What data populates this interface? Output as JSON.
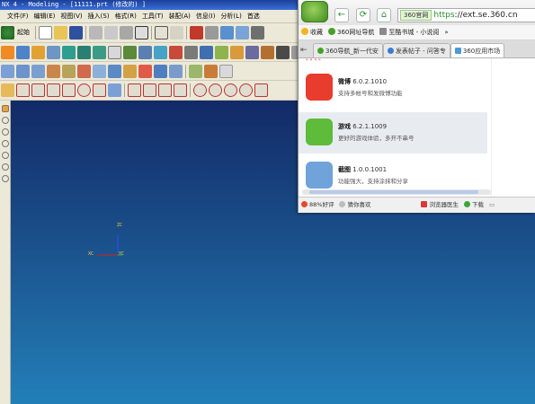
{
  "nx": {
    "title": "NX 4 - Modeling - [11111.prt  (修改的) ]",
    "menu": [
      "文件(F)",
      "编辑(E)",
      "视图(V)",
      "插入(S)",
      "格式(R)",
      "工具(T)",
      "装配(A)",
      "信息(I)",
      "分析(L)",
      "首选"
    ],
    "start_label": "起始",
    "axis_labels": {
      "zc": "ZC",
      "xc": "XC",
      "yc": "YC"
    }
  },
  "browser": {
    "address": {
      "site": "360官网",
      "protocol": "https",
      "url": "://ext.se.360.cn"
    },
    "favorites": [
      "收藏",
      "360网址导航",
      "至酷书城 - 小说阅",
      "»"
    ],
    "tabs": [
      "360导航_新一代安",
      "发表帖子 - 问答专",
      "360应用市场"
    ],
    "partial_top_text": "\" \" \" \"",
    "apps": [
      {
        "name": "微博",
        "version": "6.0.2.1010",
        "desc": "支持多帐号和发微博功能",
        "color": "#e83c2e"
      },
      {
        "name": "游戏",
        "version": "6.2.1.1009",
        "desc": "更好的游戏体验，多开不串号",
        "color": "#5fbb3a"
      },
      {
        "name": "截图",
        "version": "1.0.0.1001",
        "desc": "功能强大，支持涂抹和分享",
        "color": "#6fa3d9"
      }
    ],
    "status": {
      "rating": "88%好评",
      "guess": "猜你喜欢",
      "doctor": "浏览器医生",
      "download": "下载"
    }
  }
}
